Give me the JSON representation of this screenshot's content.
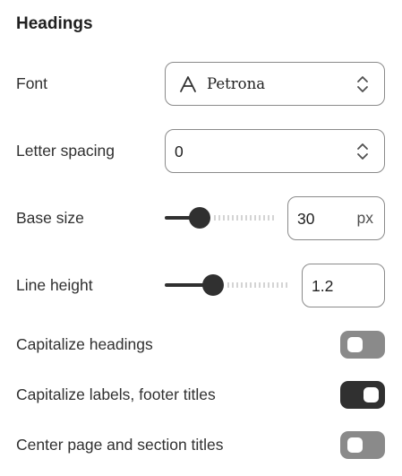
{
  "section": {
    "title": "Headings"
  },
  "font": {
    "label": "Font",
    "value": "Petrona",
    "icon": "font-icon"
  },
  "letter_spacing": {
    "label": "Letter spacing",
    "value": "0"
  },
  "base_size": {
    "label": "Base size",
    "value": "30",
    "unit": "px",
    "slider_fraction": 0.27
  },
  "line_height": {
    "label": "Line height",
    "value": "1.2",
    "slider_fraction": 0.36
  },
  "toggles": [
    {
      "label": "Capitalize headings",
      "on": false
    },
    {
      "label": "Capitalize labels, footer titles",
      "on": true
    },
    {
      "label": "Center page and section titles",
      "on": false
    }
  ],
  "colors": {
    "text": "#303030",
    "toggle_on": "#303030",
    "toggle_off": "#8a8a8a",
    "border": "#8a8a8a"
  }
}
